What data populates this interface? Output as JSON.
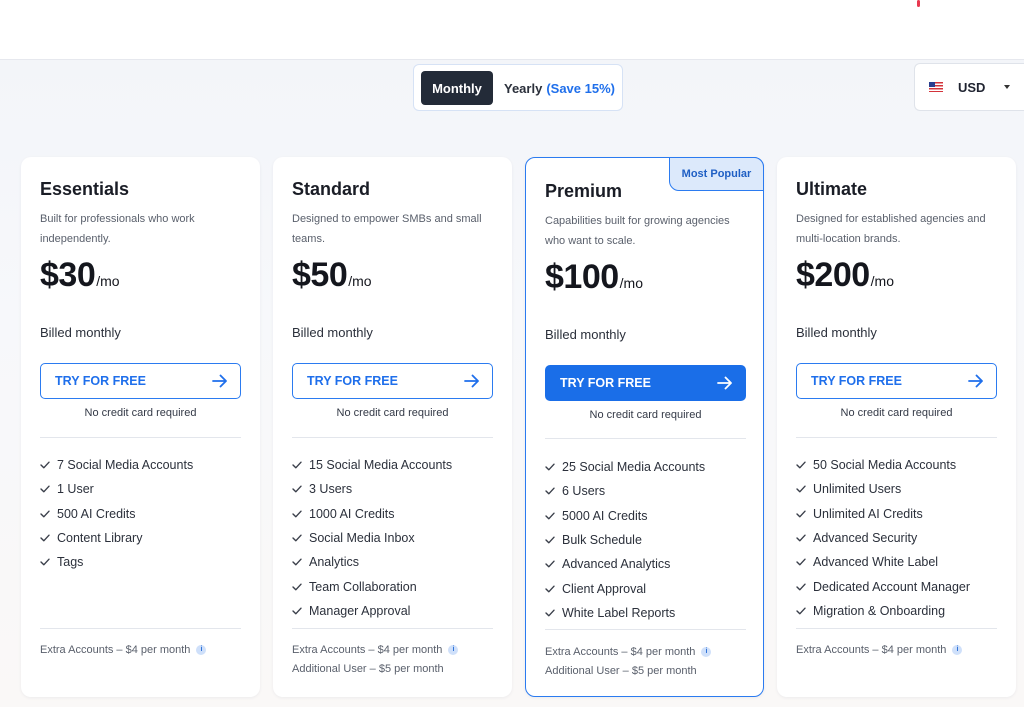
{
  "billing_toggle": {
    "monthly_label": "Monthly",
    "yearly_label": "Yearly",
    "yearly_save": "(Save 15%)"
  },
  "currency": {
    "code": "USD"
  },
  "colors": {
    "accent": "#1a6ee8",
    "dark": "#232b38",
    "badge_bg": "#dce9fb"
  },
  "plans": [
    {
      "name": "Essentials",
      "description": "Built for professionals who work independently.",
      "price": "$30",
      "per": "/mo",
      "billed": "Billed monthly",
      "cta": "TRY FOR FREE",
      "no_cc": "No credit card required",
      "features": [
        "7 Social Media Accounts",
        "1 User",
        "500 AI Credits",
        "Content Library",
        "Tags"
      ],
      "extras": [
        "Extra Accounts – $4 per month"
      ]
    },
    {
      "name": "Standard",
      "description": "Designed to empower SMBs and small teams.",
      "price": "$50",
      "per": "/mo",
      "billed": "Billed monthly",
      "cta": "TRY FOR FREE",
      "no_cc": "No credit card required",
      "features": [
        "15 Social Media Accounts",
        "3 Users",
        "1000 AI Credits",
        "Social Media Inbox",
        "Analytics",
        "Team Collaboration",
        "Manager Approval"
      ],
      "extras": [
        "Extra Accounts – $4 per month",
        "Additional User – $5 per month"
      ]
    },
    {
      "name": "Premium",
      "badge": "Most Popular",
      "description": "Capabilities built for growing agencies who want to scale.",
      "price": "$100",
      "per": "/mo",
      "billed": "Billed monthly",
      "cta": "TRY FOR FREE",
      "no_cc": "No credit card required",
      "features": [
        "25 Social Media Accounts",
        "6 Users",
        "5000 AI Credits",
        "Bulk Schedule",
        "Advanced Analytics",
        "Client Approval",
        "White Label Reports"
      ],
      "extras": [
        "Extra Accounts – $4 per month",
        "Additional User – $5 per month"
      ]
    },
    {
      "name": "Ultimate",
      "description": "Designed for established agencies and multi-location brands.",
      "price": "$200",
      "per": "/mo",
      "billed": "Billed monthly",
      "cta": "TRY FOR FREE",
      "no_cc": "No credit card required",
      "features": [
        "50 Social Media Accounts",
        "Unlimited Users",
        "Unlimited AI Credits",
        "Advanced Security",
        "Advanced White Label",
        "Dedicated Account Manager",
        "Migration & Onboarding"
      ],
      "extras": [
        "Extra Accounts – $4 per month"
      ]
    }
  ]
}
